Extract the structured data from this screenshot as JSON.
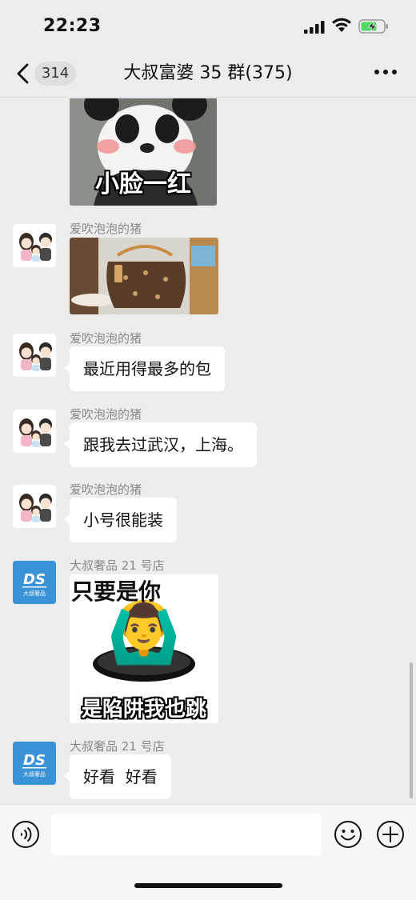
{
  "status_bar": {
    "time": "22:23",
    "signal_icon": "cellular-signal-icon",
    "wifi_icon": "wifi-icon",
    "battery_icon": "battery-charging-icon"
  },
  "nav": {
    "back_icon": "chevron-left-icon",
    "unread_count": "314",
    "title": "大叔富婆 35 群(375)",
    "more_icon": "more-dots-icon"
  },
  "messages": [
    {
      "type": "sticker",
      "sender": "",
      "caption": "小脸一红",
      "depicts": "panda-sticker"
    },
    {
      "type": "image",
      "sender": "爱吹泡泡的猪",
      "depicts": "handbag-photo"
    },
    {
      "type": "text",
      "sender": "爱吹泡泡的猪",
      "text": "最近用得最多的包"
    },
    {
      "type": "text",
      "sender": "爱吹泡泡的猪",
      "text": "跟我去过武汉，上海。"
    },
    {
      "type": "text",
      "sender": "爱吹泡泡的猪",
      "text": "小号很能装"
    },
    {
      "type": "sticker",
      "sender": "大叔奢品 21 号店",
      "caption_top": "只要是你",
      "caption_bottom": "是陷阱我也跳",
      "emoji": "🙆‍♂️"
    },
    {
      "type": "text",
      "sender": "大叔奢品 21 号店",
      "text": "好看  好看"
    }
  ],
  "avatars": {
    "family": "family-cartoon-avatar",
    "shop": "ds-logo-avatar",
    "shop_logo_text": "DS",
    "shop_logo_sub": "大叔奢品"
  },
  "input_bar": {
    "voice_icon": "voice-icon",
    "input_value": "",
    "input_placeholder": "",
    "emoji_icon": "emoji-icon",
    "add_icon": "plus-circle-icon"
  },
  "colors": {
    "background": "#ededed",
    "bubble": "#ffffff",
    "shop_avatar": "#3a93d6",
    "battery_fill": "#4cd964"
  }
}
